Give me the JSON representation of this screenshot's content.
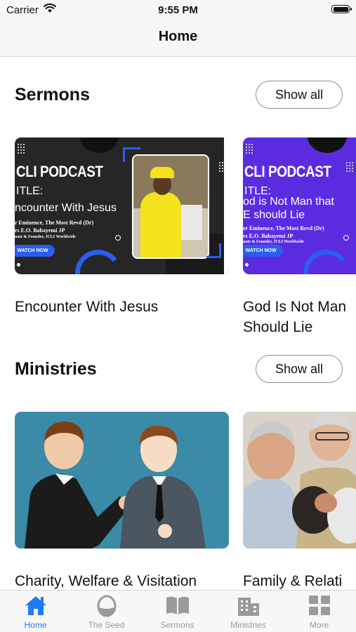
{
  "status_bar": {
    "carrier": "Carrier",
    "time": "9:55 PM"
  },
  "nav": {
    "title": "Home"
  },
  "sermons": {
    "title": "Sermons",
    "show_all": "Show all",
    "items": [
      {
        "title": "Encounter With Jesus",
        "thumb": {
          "brand": "CLI PODCAST",
          "label": "ITLE:",
          "subject": "ncounter With Jesus",
          "by1": "r Eminence, The Most Revd (Dr)",
          "by2": "rs E.O. Babayemi JP",
          "by3": "nate & Founder, JCLI Worldwide",
          "watch": "WATCH NOW"
        }
      },
      {
        "title_line1": "God Is Not Man",
        "title_line2": "Should Lie",
        "thumb": {
          "brand": "CLI PODCAST",
          "label": "ITLE:",
          "subject1": "od is Not Man that",
          "subject2": "E should Lie",
          "by1": "er Eminence, The Most Revd (Dr)",
          "by2": "rs E.O. Babayemi JP",
          "by3": "nate & Founder, JCLI Worldwide",
          "watch": "WATCH NOW"
        }
      }
    ]
  },
  "ministries": {
    "title": "Ministries",
    "show_all": "Show all",
    "items": [
      {
        "title": "Charity, Welfare & Visitation"
      },
      {
        "title": "Family & Relati"
      }
    ]
  },
  "tabbar": {
    "items": [
      {
        "label": "Home",
        "icon": "house-icon",
        "active": true
      },
      {
        "label": "The Seed",
        "icon": "seed-icon",
        "active": false
      },
      {
        "label": "Sermons",
        "icon": "book-icon",
        "active": false
      },
      {
        "label": "Ministries",
        "icon": "building-icon",
        "active": false
      },
      {
        "label": "More",
        "icon": "grid-icon",
        "active": false
      }
    ],
    "active_color": "#1f7cf5",
    "inactive_color": "#9a9a9a"
  }
}
